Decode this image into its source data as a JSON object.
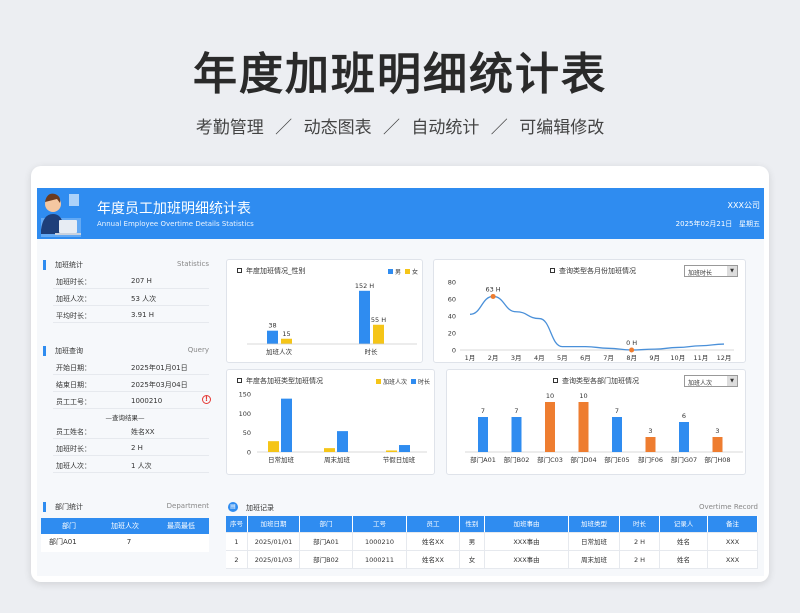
{
  "page": {
    "title": "年度加班明细统计表",
    "subtitle": "考勤管理 ／ 动态图表 ／ 自动统计 ／ 可编辑修改"
  },
  "header": {
    "title": "年度员工加班明细统计表",
    "subtitle_en": "Annual Employee Overtime Details Statistics",
    "company": "XXX公司",
    "date": "2025年02月21日",
    "weekday": "星期五"
  },
  "stats": {
    "title": "加班统计",
    "title_en": "Statistics",
    "rows": [
      {
        "label": "加班时长：",
        "value": "207 H"
      },
      {
        "label": "加班人次：",
        "value": "53 人次"
      },
      {
        "label": "平均时长：",
        "value": "3.91 H"
      }
    ]
  },
  "query": {
    "title": "加班查询",
    "title_en": "Query",
    "start_label": "开始日期：",
    "start_value": "2025年01月01日",
    "end_label": "结束日期：",
    "end_value": "2025年03月04日",
    "emp_label": "员工工号：",
    "emp_value": "1000210",
    "warn": "!",
    "result_label": "—查询结果—",
    "name_label": "员工姓名：",
    "name_value": "姓名XX",
    "dur_label": "加班时长：",
    "dur_value": "2 H",
    "count_label": "加班人次：",
    "count_value": "1 人次"
  },
  "dept": {
    "title": "部门统计",
    "title_en": "Department",
    "columns": [
      "部门",
      "加班人次",
      "最高最低"
    ],
    "rows": [
      [
        "部门A01",
        "7",
        ""
      ]
    ]
  },
  "chart_data": [
    {
      "type": "bar",
      "title": "年度加班情况_性别",
      "categories": [
        "加班人次",
        "时长"
      ],
      "series": [
        {
          "name": "男",
          "values": [
            38,
            152
          ]
        },
        {
          "name": "女",
          "values": [
            15,
            55
          ]
        }
      ],
      "data_labels": [
        [
          "38",
          "15"
        ],
        [
          "152 H",
          "55 H"
        ]
      ]
    },
    {
      "type": "line",
      "title": "查询类型各月份加班情况",
      "dropdown": "加班时长",
      "categories": [
        "1月",
        "2月",
        "3月",
        "4月",
        "5月",
        "6月",
        "7月",
        "8月",
        "9月",
        "10月",
        "11月",
        "12月"
      ],
      "values": [
        42,
        63,
        45,
        37,
        4,
        4,
        2,
        0,
        1,
        3,
        5,
        7
      ],
      "annotations": [
        {
          "x": "2月",
          "label": "63 H"
        },
        {
          "x": "8月",
          "label": "0 H"
        }
      ],
      "ylim": [
        0,
        80
      ],
      "yticks": [
        "0",
        "20",
        "40",
        "60",
        "80"
      ]
    },
    {
      "type": "bar",
      "title": "年度各加班类型加班情况",
      "categories": [
        "日常加班",
        "周末加班",
        "节假日加班"
      ],
      "series": [
        {
          "name": "加班人次",
          "values": [
            28,
            10,
            4
          ]
        },
        {
          "name": "时长",
          "values": [
            138,
            54,
            18
          ]
        }
      ],
      "ylim": [
        0,
        150
      ],
      "yticks": [
        "0",
        "50",
        "100",
        "150"
      ]
    },
    {
      "type": "bar",
      "title": "查询类型各部门加班情况",
      "dropdown": "加班人次",
      "categories": [
        "部门A01",
        "部门B02",
        "部门C03",
        "部门D04",
        "部门E05",
        "部门F06",
        "部门G07",
        "部门H08"
      ],
      "values": [
        7,
        7,
        10,
        10,
        7,
        3,
        6,
        3
      ],
      "highlight": [
        "部门C03",
        "部门D04",
        "部门F06",
        "部门H08"
      ]
    }
  ],
  "records": {
    "title": "加班记录",
    "title_en": "Overtime Record",
    "columns": [
      "序号",
      "加班日期",
      "部门",
      "工号",
      "员工",
      "性别",
      "加班事由",
      "加班类型",
      "时长",
      "记录人",
      "备注"
    ],
    "rows": [
      [
        "1",
        "2025/01/01",
        "部门A01",
        "1000210",
        "姓名XX",
        "男",
        "XXX事由",
        "日常加班",
        "2 H",
        "姓名",
        "XXX"
      ],
      [
        "2",
        "2025/01/03",
        "部门B02",
        "1000211",
        "姓名XX",
        "女",
        "XXX事由",
        "周末加班",
        "2 H",
        "姓名",
        "XXX"
      ]
    ]
  },
  "colors": {
    "blue": "#2f8cf0",
    "orange": "#f0a030",
    "yellow": "#f5c518",
    "deep_orange": "#ee7d30",
    "line": "#4a90d9"
  }
}
